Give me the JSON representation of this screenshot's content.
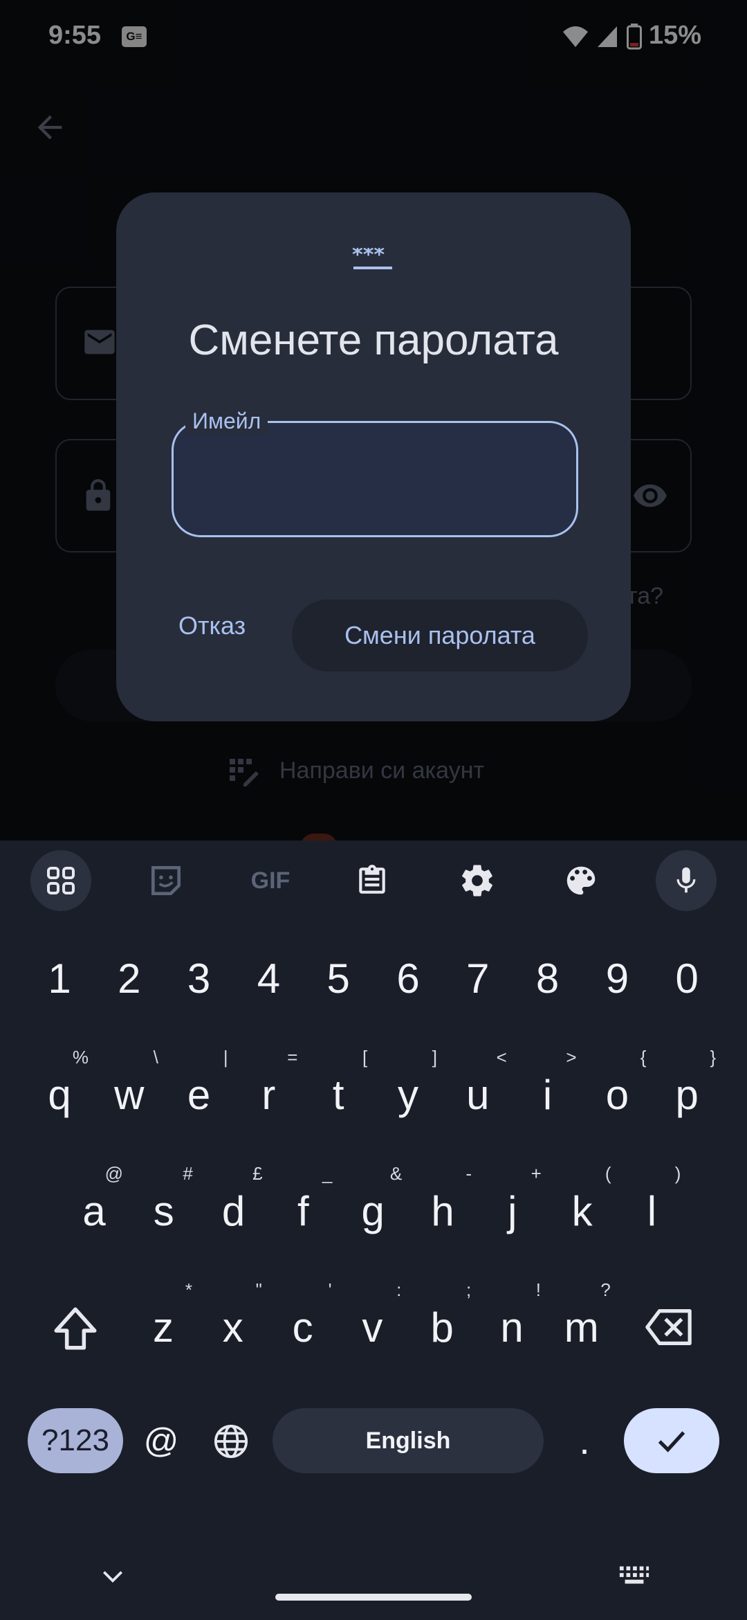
{
  "status_bar": {
    "time": "9:55",
    "notification_badge": "G≡",
    "battery": "15%",
    "icons": [
      "wifi-icon",
      "signal-icon",
      "battery-icon"
    ]
  },
  "background": {
    "back_icon": "arrow-back-icon",
    "partial_forgot_text": "та?",
    "create_account": "Направи си акаунт",
    "field_icons": [
      "mail-icon",
      "lock-icon",
      "eye-icon"
    ]
  },
  "dialog": {
    "icon": "password-icon",
    "title": "Сменете паролата",
    "email_label": "Имейл",
    "email_value": "",
    "cancel": "Отказ",
    "confirm": "Смени паролата"
  },
  "keyboard": {
    "toolbar": [
      "apps-grid-icon",
      "sticker-icon",
      "GIF",
      "clipboard-icon",
      "gear-icon",
      "palette-icon",
      "mic-icon"
    ],
    "gif_label": "GIF",
    "numbers": [
      "1",
      "2",
      "3",
      "4",
      "5",
      "6",
      "7",
      "8",
      "9",
      "0"
    ],
    "row1": [
      {
        "k": "q",
        "s": "%"
      },
      {
        "k": "w",
        "s": "\\"
      },
      {
        "k": "e",
        "s": "|"
      },
      {
        "k": "r",
        "s": "="
      },
      {
        "k": "t",
        "s": "["
      },
      {
        "k": "y",
        "s": "]"
      },
      {
        "k": "u",
        "s": "<"
      },
      {
        "k": "i",
        "s": ">"
      },
      {
        "k": "o",
        "s": "{"
      },
      {
        "k": "p",
        "s": "}"
      }
    ],
    "row2": [
      {
        "k": "a",
        "s": "@"
      },
      {
        "k": "s",
        "s": "#"
      },
      {
        "k": "d",
        "s": "£"
      },
      {
        "k": "f",
        "s": "_"
      },
      {
        "k": "g",
        "s": "&"
      },
      {
        "k": "h",
        "s": "-"
      },
      {
        "k": "j",
        "s": "+"
      },
      {
        "k": "k",
        "s": "("
      },
      {
        "k": "l",
        "s": ")"
      }
    ],
    "row3": [
      {
        "k": "z",
        "s": "*"
      },
      {
        "k": "x",
        "s": "\""
      },
      {
        "k": "c",
        "s": "'"
      },
      {
        "k": "v",
        "s": ":"
      },
      {
        "k": "b",
        "s": ";"
      },
      {
        "k": "n",
        "s": "!"
      },
      {
        "k": "m",
        "s": "?"
      }
    ],
    "symbols_key": "?123",
    "at_key": "@",
    "space_label": "English",
    "period_key": ".",
    "nav": [
      "chevron-down-icon",
      "keyboard-icon"
    ]
  },
  "colors": {
    "accent": "#a9c1ef",
    "dialog_bg": "#282d3b",
    "keyboard_bg": "#1a1e29",
    "enter_key": "#d6e2ff"
  }
}
